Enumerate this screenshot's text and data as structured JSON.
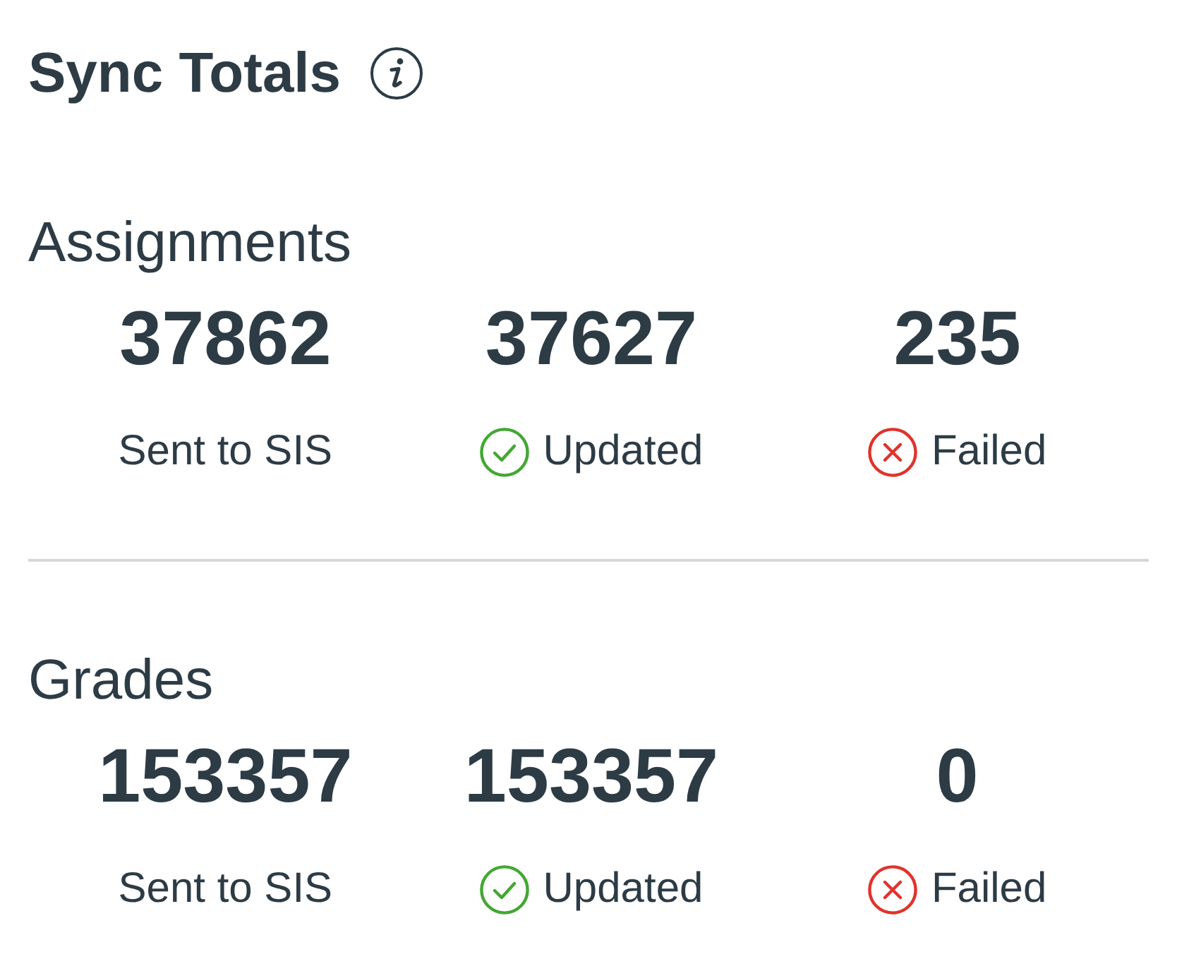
{
  "title": "Sync Totals",
  "sections": [
    {
      "heading": "Assignments",
      "stats": [
        {
          "kind": "sent",
          "value": "37862",
          "label": "Sent to SIS"
        },
        {
          "kind": "updated",
          "value": "37627",
          "label": "Updated"
        },
        {
          "kind": "failed",
          "value": "235",
          "label": "Failed"
        }
      ]
    },
    {
      "heading": "Grades",
      "stats": [
        {
          "kind": "sent",
          "value": "153357",
          "label": "Sent to SIS"
        },
        {
          "kind": "updated",
          "value": "153357",
          "label": "Updated"
        },
        {
          "kind": "failed",
          "value": "0",
          "label": "Failed"
        }
      ]
    }
  ]
}
